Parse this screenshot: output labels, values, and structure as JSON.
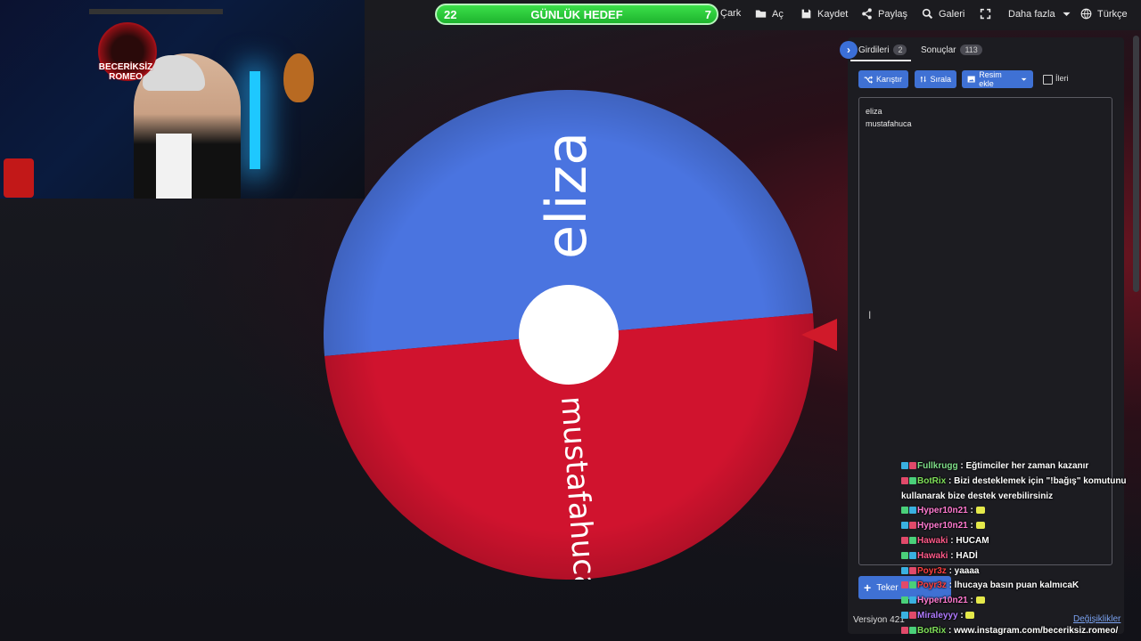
{
  "goal": {
    "left": "22",
    "title": "GÜNLÜK HEDEF",
    "right": "7"
  },
  "nav": {
    "wheel": "Çark",
    "open": "Aç",
    "save": "Kaydet",
    "share": "Paylaş",
    "gallery": "Galeri",
    "more": "Daha fazla",
    "language": "Türkçe"
  },
  "webcam": {
    "logo_text": "BECERİKSİZ ROMEO"
  },
  "wheel": {
    "segments": [
      {
        "label": "eliza",
        "color": "#4a74e0"
      },
      {
        "label": "mustafahuca",
        "color": "#d0132e"
      }
    ],
    "hub_color": "#ffffff",
    "pointer_color": "#d01a2a"
  },
  "panel": {
    "tab_entries": "Girdileri",
    "tab_entries_count": "2",
    "tab_results": "Sonuçlar",
    "tab_results_count": "113",
    "shuffle": "Karıştır",
    "sort": "Sırala",
    "add_image": "Resim ekle",
    "advanced": "İleri",
    "entries": [
      "eliza",
      "mustafahuca"
    ],
    "add_wheel": "Teker",
    "version": "Versiyon 421",
    "changes": "Değişiklikler"
  },
  "chat": [
    {
      "user": "Fullkrugg",
      "user_color": "#7fe08a",
      "text": " : Eğtimciler her zaman kazanır",
      "emote": false
    },
    {
      "user": "BotRix",
      "user_color": "#7fe05a",
      "text": " : Bizi desteklemek için \"!bağış\" komutunu kullanarak bize destek verebilirsiniz",
      "emote": false
    },
    {
      "user": "Hyper10n21",
      "user_color": "#ff7ad0",
      "text": " : ",
      "emote": true
    },
    {
      "user": "Hyper10n21",
      "user_color": "#ff7ad0",
      "text": " : ",
      "emote": true
    },
    {
      "user": "Hawaki",
      "user_color": "#ff5a8a",
      "text": " : HUCAM",
      "emote": false
    },
    {
      "user": "Hawaki",
      "user_color": "#ff5a8a",
      "text": " : HADİ",
      "emote": false
    },
    {
      "user": "Poyr3z",
      "user_color": "#ff4040",
      "text": " : yaaaa",
      "emote": false
    },
    {
      "user": "Poyr3z",
      "user_color": "#ff4040",
      "text": " : lhucaya basın puan kalmıcaK",
      "emote": false
    },
    {
      "user": "Hyper10n21",
      "user_color": "#ff7ad0",
      "text": " : ",
      "emote": true
    },
    {
      "user": "Miraleyyy",
      "user_color": "#b07aff",
      "text": " : ",
      "emote": true
    },
    {
      "user": "BotRix",
      "user_color": "#7fe05a",
      "text": " : www.instagram.com/beceriksiz.romeo/",
      "emote": false
    }
  ]
}
